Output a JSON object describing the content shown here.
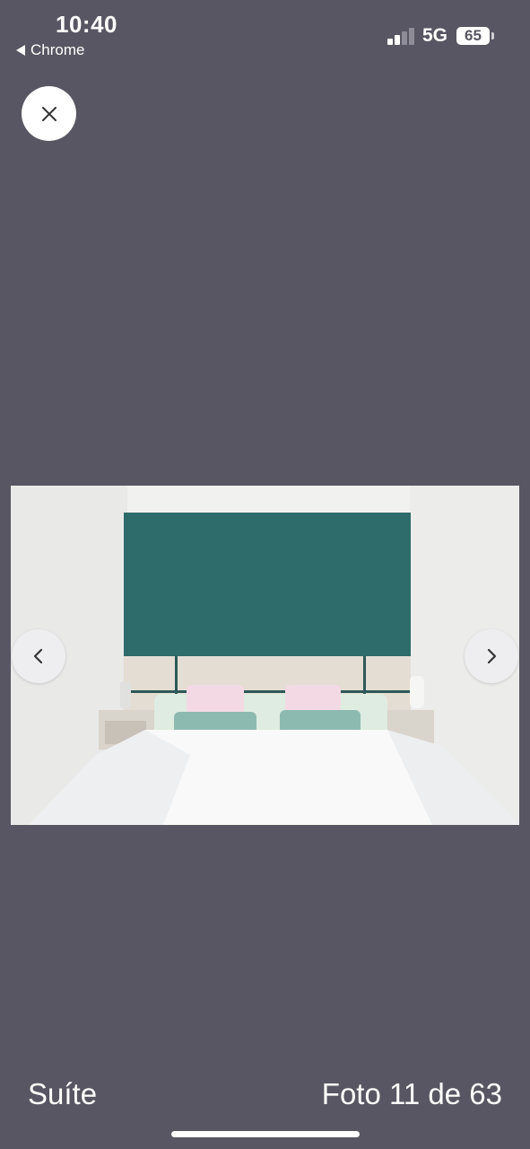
{
  "status_bar": {
    "time": "10:40",
    "back_app_label": "Chrome",
    "network": "5G",
    "battery": "65",
    "signal_bars_active": 2,
    "signal_bars_total": 4
  },
  "viewer": {
    "close_icon": "close-icon",
    "prev_icon": "chevron-left-icon",
    "next_icon": "chevron-right-icon",
    "photo_subject": "bedroom-photo",
    "caption": "Suíte",
    "counter": "Foto 11 de 63"
  },
  "colors": {
    "background": "#575662",
    "accent_wall": "#2e6b6b",
    "button_bg": "#ffffff"
  }
}
